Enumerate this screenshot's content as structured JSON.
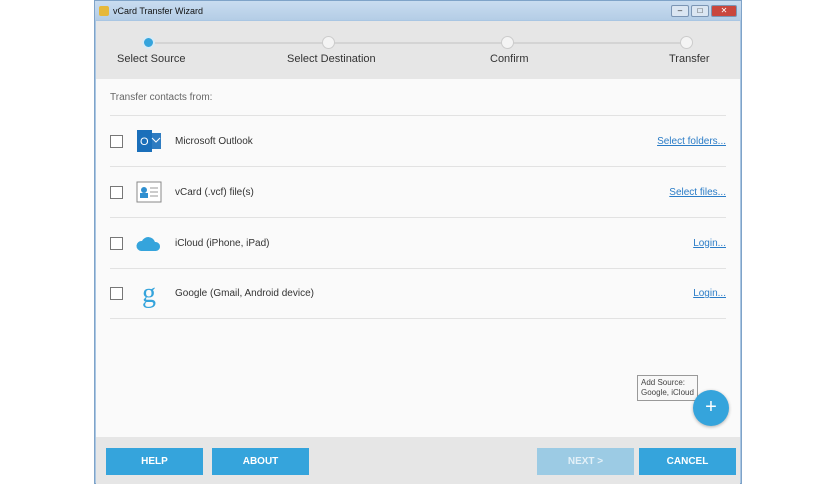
{
  "window": {
    "title": "vCard Transfer Wizard"
  },
  "steps": [
    {
      "label": "Select Source",
      "active": true
    },
    {
      "label": "Select Destination",
      "active": false
    },
    {
      "label": "Confirm",
      "active": false
    },
    {
      "label": "Transfer",
      "active": false
    }
  ],
  "content": {
    "heading": "Transfer contacts from:",
    "sources": [
      {
        "label": "Microsoft Outlook",
        "link": "Select folders...",
        "icon": "outlook-icon"
      },
      {
        "label": "vCard (.vcf) file(s)",
        "link": "Select files...",
        "icon": "vcard-icon"
      },
      {
        "label": "iCloud (iPhone, iPad)",
        "link": "Login...",
        "icon": "cloud-icon"
      },
      {
        "label": "Google (Gmail, Android device)",
        "link": "Login...",
        "icon": "google-icon"
      }
    ],
    "tooltip_line1": "Add Source:",
    "tooltip_line2": "Google, iCloud",
    "add_button": "+"
  },
  "footer": {
    "help": "HELP",
    "about": "ABOUT",
    "next": "NEXT >",
    "cancel": "CANCEL"
  },
  "colors": {
    "accent": "#35a4dc",
    "link": "#2a7cc7"
  }
}
